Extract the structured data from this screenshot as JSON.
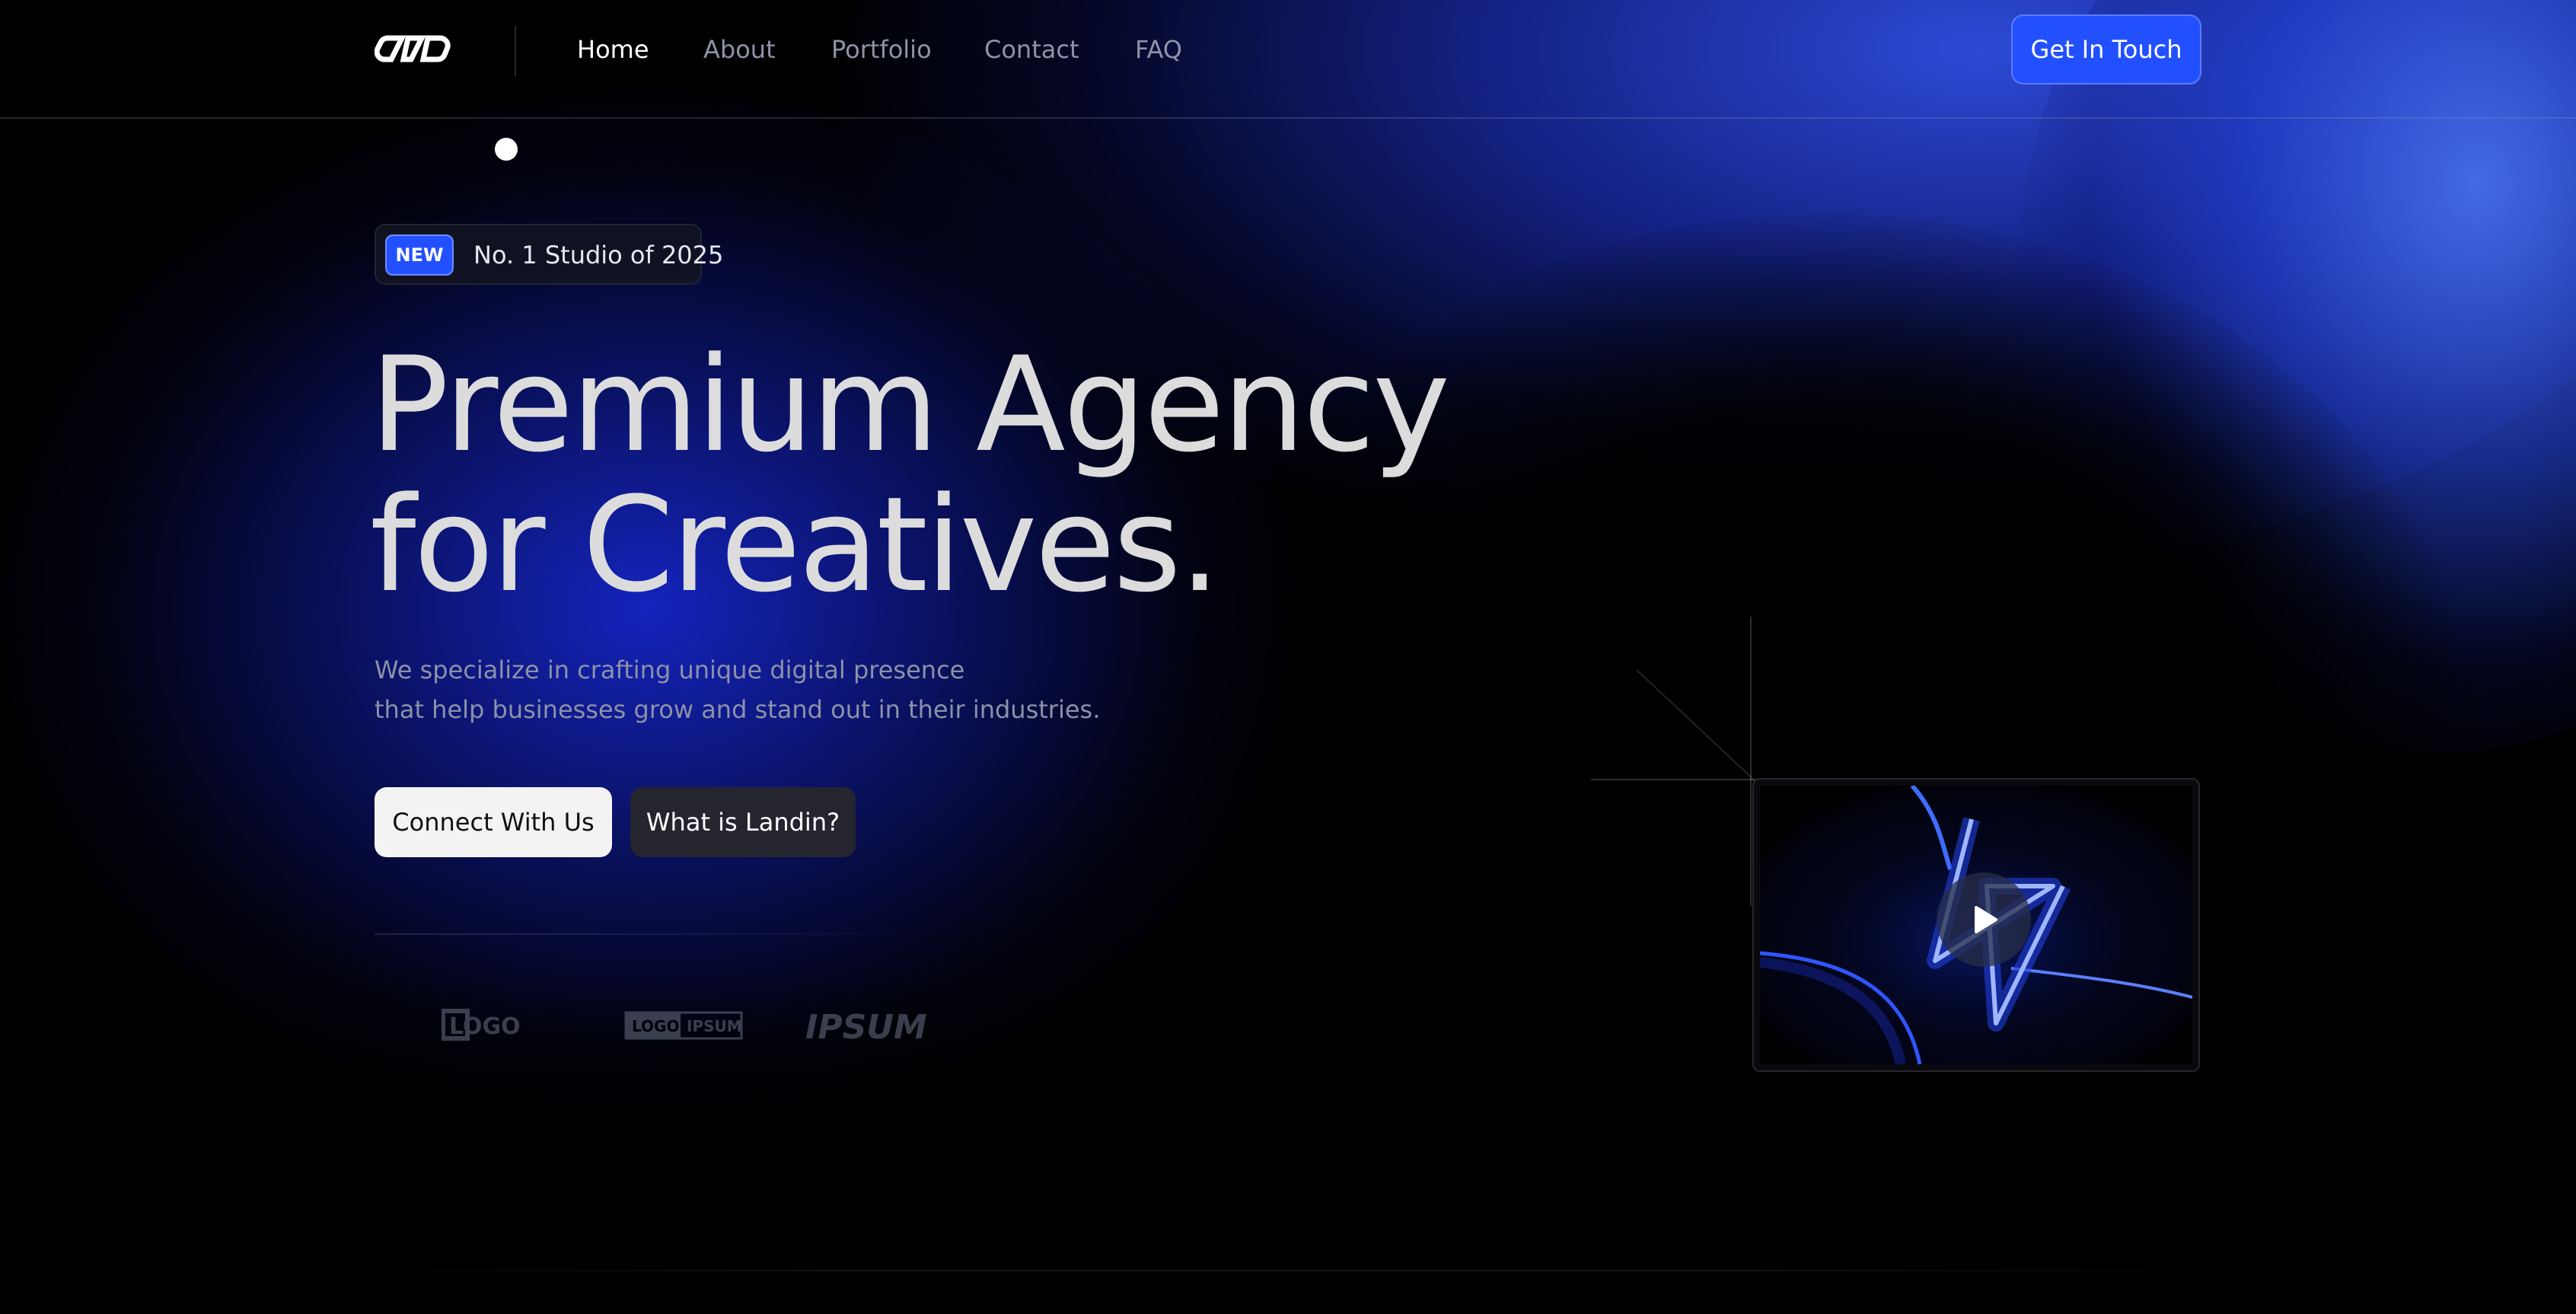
{
  "nav": {
    "logo_icon": "infinity-chain-icon",
    "items": [
      {
        "label": "Home",
        "active": true
      },
      {
        "label": "About",
        "active": false
      },
      {
        "label": "Portfolio",
        "active": false
      },
      {
        "label": "Contact",
        "active": false
      },
      {
        "label": "FAQ",
        "active": false
      }
    ],
    "cta_label": "Get In Touch"
  },
  "badge": {
    "tag": "NEW",
    "text": "No. 1 Studio of 2025"
  },
  "hero": {
    "title_line1": "Premium Agency",
    "title_line2": "for Creatives.",
    "subtitle_line1": "We specialize in crafting unique digital presence",
    "subtitle_line2": "that help businesses grow and stand out in their industries.",
    "primary_button": "Connect With Us",
    "secondary_button": "What is Landin?"
  },
  "partner_logos": {
    "logo1": "LOGO",
    "logo2_part1": "LOGO",
    "logo2_part2": "IPSUM",
    "logo3": "IPSUM"
  },
  "video": {
    "icon": "play-icon"
  },
  "colors": {
    "accent": "#2350ff",
    "background": "#000000",
    "headline": "#dcdcdc",
    "muted_text": "#8c91a8"
  }
}
